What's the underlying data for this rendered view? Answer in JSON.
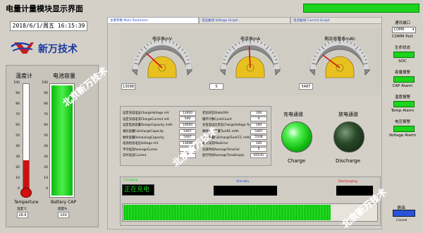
{
  "window": {
    "title": "电量计量模块显示界面"
  },
  "datetime": "2018/6/1/周五 16:15:39",
  "logo": {
    "text": "新万技术"
  },
  "left": {
    "temp_heading": "温度计",
    "battery_heading": "电池容量",
    "temp_ticks": [
      "100",
      "90",
      "80",
      "70",
      "60",
      "50",
      "40",
      "30",
      "20",
      "10",
      "0"
    ],
    "battery_ticks": [
      "100",
      "90",
      "80",
      "70",
      "60",
      "50",
      "40",
      "30",
      "20",
      "10",
      "0"
    ],
    "temp_level": 0.28,
    "battery_level": 1.0,
    "temp_caption": "Temperture",
    "battery_caption": "Battery CAP",
    "temp_unit_label": "温度℃",
    "temp_value": "28.6",
    "cap_unit_label": "容量%",
    "cap_value": "100"
  },
  "tabs": [
    {
      "label": "主要参数 Main Parament"
    },
    {
      "label": "电压曲线 Voltage Graph"
    },
    {
      "label": "电流曲线 Current Graph"
    }
  ],
  "gauges": [
    {
      "label": "电压表mV",
      "value": "13098"
    },
    {
      "label": "电流表mA",
      "value": "5"
    },
    {
      "label": "剩余容量表mAh",
      "value": "5487"
    }
  ],
  "params_left": [
    {
      "label": "设定充电电压ChargeVoltage mV",
      "value": "12600"
    },
    {
      "label": "设定充电电流ChargeCurrent mA",
      "value": "500"
    },
    {
      "label": "设定电池容量DesignCapacity mAh",
      "value": "10000"
    },
    {
      "label": "满充容量FullchargeCapacity",
      "value": "5487"
    },
    {
      "label": "剩余容量RemainingCapacity",
      "value": "5487"
    },
    {
      "label": "电池组总电压Voltage mV",
      "value": "13098"
    },
    {
      "label": "平均电流AverageCurren",
      "value": "5"
    },
    {
      "label": "实时电流Current",
      "value": "4"
    }
  ],
  "params_right": [
    {
      "label": "老化状态StateOfH",
      "value": "100"
    },
    {
      "label": "循环计数CycleCount",
      "value": "0"
    },
    {
      "label": "充电电压比状态ChargeVoltage %",
      "value": "100"
    },
    {
      "label": "剩余充电容量TureRC mAh",
      "value": "5487"
    },
    {
      "label": "满充容量FullchargeTureFCC mAh",
      "value": "5508"
    },
    {
      "label": "最大误差MaxError",
      "value": "100"
    },
    {
      "label": "充满时间AverageTimeFull",
      "value": "0"
    },
    {
      "label": "放空时间AverageTimeEmpty",
      "value": "65535"
    }
  ],
  "channels": {
    "charge_heading": "充电通道",
    "discharge_heading": "放电通道",
    "charge_caption": "Charge",
    "discharge_caption": "Discharge"
  },
  "status": {
    "charging_label": "Charging",
    "charging_text": "正在充电",
    "standby_label": "Standby",
    "discharging_label": "Discharging",
    "progress": 0.82
  },
  "right": {
    "comm_heading": "通讯端口",
    "comm_value": "COM6",
    "comm_caption": "COMM Port",
    "soc_heading": "生命状态",
    "soc_caption": "SOC",
    "cap_alarm_heading": "容量报警",
    "cap_alarm_caption": "CAP Alarm",
    "temp_alarm_heading": "温度报警",
    "temp_alarm_caption": "Temp Alarm",
    "volt_alarm_heading": "电压报警",
    "volt_alarm_caption": "Voltage Alarm",
    "exit_label": "退出",
    "exit_caption": "Cancel"
  },
  "watermark": "北京新万技术",
  "colors": {
    "green": "#1bd41b",
    "blue_btn": "#2a52d8",
    "red": "#d01010",
    "yellow": "#e8c020"
  }
}
